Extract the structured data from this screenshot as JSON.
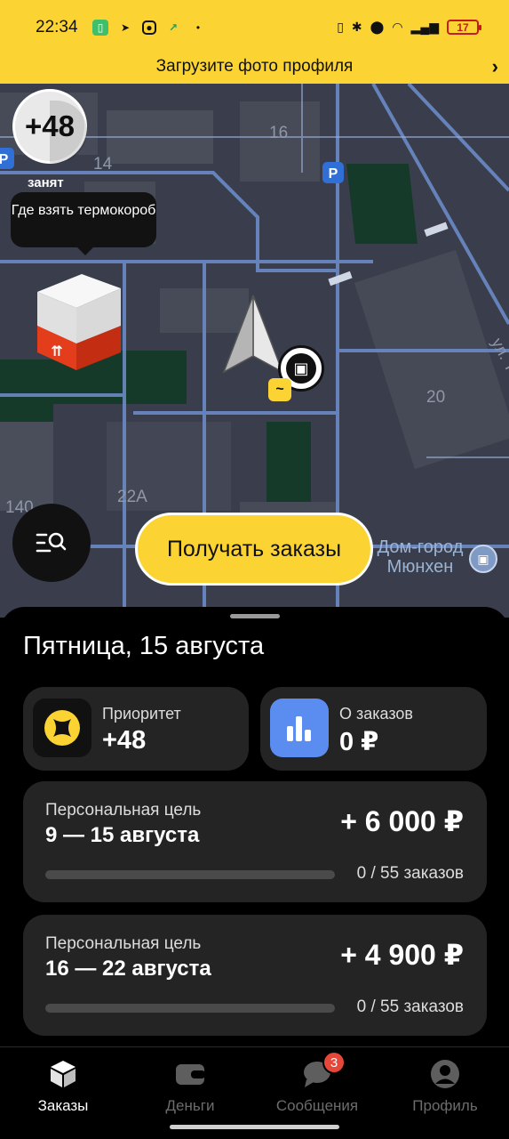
{
  "status_bar": {
    "time": "22:34",
    "battery": "17",
    "icons": [
      "app-icon",
      "telegram-icon",
      "instagram-icon",
      "arrow-icon",
      "dot-icon",
      "vibrate-icon",
      "bluetooth-icon",
      "location-icon",
      "wifi-icon",
      "signal-icon"
    ]
  },
  "banner": {
    "text": "Загрузите фото профиля"
  },
  "map": {
    "priority": "+48",
    "busy_label": "занят",
    "tooltip": "Где взять термокороб",
    "house_numbers": [
      "16",
      "14",
      "20",
      "22А",
      "140"
    ],
    "street_label": "ул. Т",
    "poi_name": "Дом-город Мюнхен",
    "parking_label": "P",
    "get_orders_label": "Получать заказы"
  },
  "sheet": {
    "date": "Пятница, 15 августа",
    "tiles": [
      {
        "label": "Приоритет",
        "value": "+48",
        "icon": "priority-icon",
        "icon_color": "#fbd433"
      },
      {
        "label": "О заказов",
        "value": "0 ₽",
        "icon": "bar-chart-icon",
        "icon_color": "#5b8df0"
      }
    ],
    "goals": [
      {
        "title": "Персональная цель",
        "period": "9 — 15 августа",
        "amount": "+ 6 000 ₽",
        "progress_text": "0 / 55 заказов",
        "progress": 0
      },
      {
        "title": "Персональная цель",
        "period": "16 — 22 августа",
        "amount": "+ 4 900 ₽",
        "progress_text": "0 / 55 заказов",
        "progress": 0
      }
    ]
  },
  "nav": {
    "items": [
      {
        "label": "Заказы",
        "icon": "box-icon",
        "active": true
      },
      {
        "label": "Деньги",
        "icon": "wallet-icon",
        "active": false
      },
      {
        "label": "Сообщения",
        "icon": "chat-icon",
        "active": false,
        "badge": "3"
      },
      {
        "label": "Профиль",
        "icon": "profile-icon",
        "active": false
      }
    ]
  },
  "colors": {
    "accent": "#fbd433",
    "background": "#000000",
    "tile": "#242424",
    "badge": "#e5473a"
  }
}
